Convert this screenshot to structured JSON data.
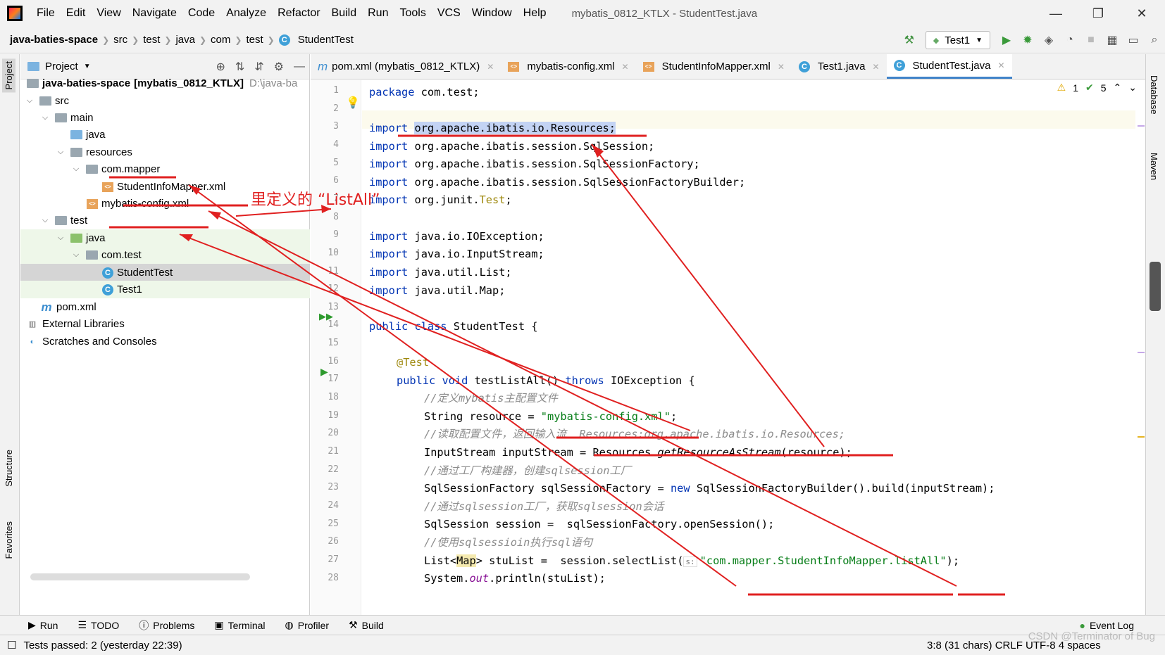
{
  "menubar": {
    "items": [
      "File",
      "Edit",
      "View",
      "Navigate",
      "Code",
      "Analyze",
      "Refactor",
      "Build",
      "Run",
      "Tools",
      "VCS",
      "Window",
      "Help"
    ],
    "window_title": "mybatis_0812_KTLX - StudentTest.java"
  },
  "breadcrumb": [
    "java-baties-space",
    "src",
    "test",
    "java",
    "com",
    "test",
    "StudentTest"
  ],
  "run_config": "Test1",
  "project_panel": {
    "title": "Project",
    "root_name": "java-baties-space",
    "root_module": "[mybatis_0812_KTLX]",
    "root_path": "D:\\java-ba",
    "nodes": [
      "src",
      "main",
      "java",
      "resources",
      "com.mapper",
      "StudentInfoMapper.xml",
      "mybatis-config.xml",
      "test",
      "java",
      "com.test",
      "StudentTest",
      "Test1",
      "pom.xml",
      "External Libraries",
      "Scratches and Consoles"
    ]
  },
  "editor_tabs": [
    "pom.xml (mybatis_0812_KTLX)",
    "mybatis-config.xml",
    "StudentInfoMapper.xml",
    "Test1.java",
    "StudentTest.java"
  ],
  "inspections": {
    "warnings": "1",
    "ok": "5"
  },
  "line_numbers": [
    "1",
    "2",
    "3",
    "4",
    "5",
    "6",
    "7",
    "8",
    "9",
    "10",
    "11",
    "12",
    "13",
    "14",
    "15",
    "16",
    "17",
    "18",
    "19",
    "20",
    "21",
    "22",
    "23",
    "24",
    "25",
    "26",
    "27",
    "28"
  ],
  "code": {
    "l1_kw": "package",
    "l1_rest": " com.test;",
    "l3_kw": "import",
    "l3_rest": "org.apache.ibatis.io.Resources;",
    "l4": "org.apache.ibatis.session.SqlSession;",
    "l5": "org.apache.ibatis.session.SqlSessionFactory;",
    "l6": "org.apache.ibatis.session.SqlSessionFactoryBuilder;",
    "l7a": "org.junit.",
    "l7b": "Test",
    "l7c": ";",
    "l9": "java.io.IOException;",
    "l10": "java.io.InputStream;",
    "l11": "java.util.List;",
    "l12": "java.util.Map;",
    "import_kw": "import",
    "l14_kw": "public class",
    "l14_rest": " StudentTest {",
    "l16": "@Test",
    "l17_kw1": "public void",
    "l17_mid": " testListAll() ",
    "l17_kw2": "throws",
    "l17_rest": " IOException {",
    "l18": "//定义mybatis主配置文件",
    "l19_a": "String resource = ",
    "l19_str": "\"mybatis-config.xml\"",
    "l19_c": ";",
    "l20": "//读取配置文件，返回输入流  Resources:org.apache.ibatis.io.Resources;",
    "l21_a": "InputStream inputStream = Resources.",
    "l21_m": "getResourceAsStream",
    "l21_c": "(resource);",
    "l22": "//通过工厂构建器，创建sqlsession工厂",
    "l23_a": "SqlSessionFactory sqlSessionFactory = ",
    "l23_kw": "new",
    "l23_c": " SqlSessionFactoryBuilder().build(inputStream);",
    "l24": "//通过sqlsession工厂，获取sqlsession会话",
    "l25": "SqlSession session =  sqlSessionFactory.openSession();",
    "l26": "//使用sqlsessioin执行sql语句",
    "l27_a": "List<",
    "l27_map": "Map",
    "l27_b": "> stuList =  session.selectList(",
    "l27_hint": "s:",
    "l27_str": "\"com.mapper.StudentInfoMapper.listAll\"",
    "l27_c": ");",
    "l28_a": "System.",
    "l28_out": "out",
    "l28_b": ".println(stuList);"
  },
  "annotation_label": "里定义的 “ListAll”",
  "left_stripe": [
    "Project",
    "Structure",
    "Favorites"
  ],
  "right_stripe": [
    "Database",
    "Maven"
  ],
  "bottom_tools": [
    "Run",
    "TODO",
    "Problems",
    "Terminal",
    "Profiler",
    "Build",
    "Event Log"
  ],
  "status": {
    "left": "Tests passed: 2 (yesterday 22:39)",
    "right": "3:8 (31 chars)  CRLF  UTF-8  4 spaces"
  },
  "watermark": "CSDN @Terminator of Bug",
  "colors": {
    "accent": "#4083c9",
    "annotation_red": "#e02020",
    "keyword": "#0033b3",
    "string": "#067d17"
  }
}
